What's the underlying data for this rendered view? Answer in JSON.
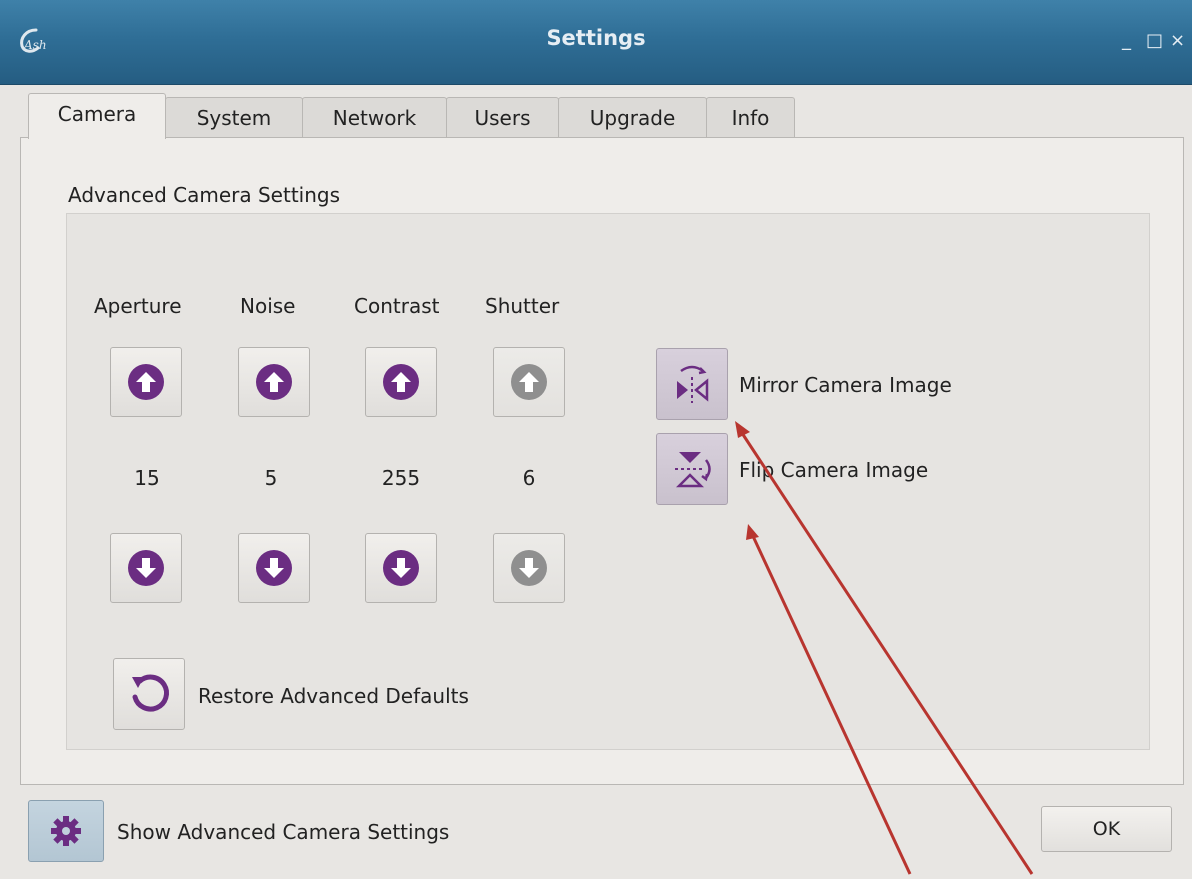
{
  "window": {
    "title": "Settings",
    "logo_text": "Ash",
    "minimize": "_",
    "maximize": "□",
    "close": "×"
  },
  "tabs": [
    {
      "label": "Camera",
      "active": true
    },
    {
      "label": "System"
    },
    {
      "label": "Network"
    },
    {
      "label": "Users"
    },
    {
      "label": "Upgrade"
    },
    {
      "label": "Info"
    }
  ],
  "camera": {
    "section_title": "Advanced Camera Settings",
    "columns": [
      {
        "label": "Aperture",
        "value": "15",
        "enabled": true
      },
      {
        "label": "Noise",
        "value": "5",
        "enabled": true
      },
      {
        "label": "Contrast",
        "value": "255",
        "enabled": true
      },
      {
        "label": "Shutter",
        "value": "6",
        "enabled": false
      }
    ],
    "mirror_label": "Mirror Camera Image",
    "flip_label": "Flip Camera Image",
    "restore_label": "Restore Advanced Defaults"
  },
  "footer": {
    "show_advanced_label": "Show Advanced Camera Settings",
    "ok_label": "OK"
  },
  "colors": {
    "accent_purple": "#6b2d82",
    "disabled_gray": "#8f8f8f",
    "annotation_red": "#b8352f",
    "title_bar": "#2f6e96"
  }
}
